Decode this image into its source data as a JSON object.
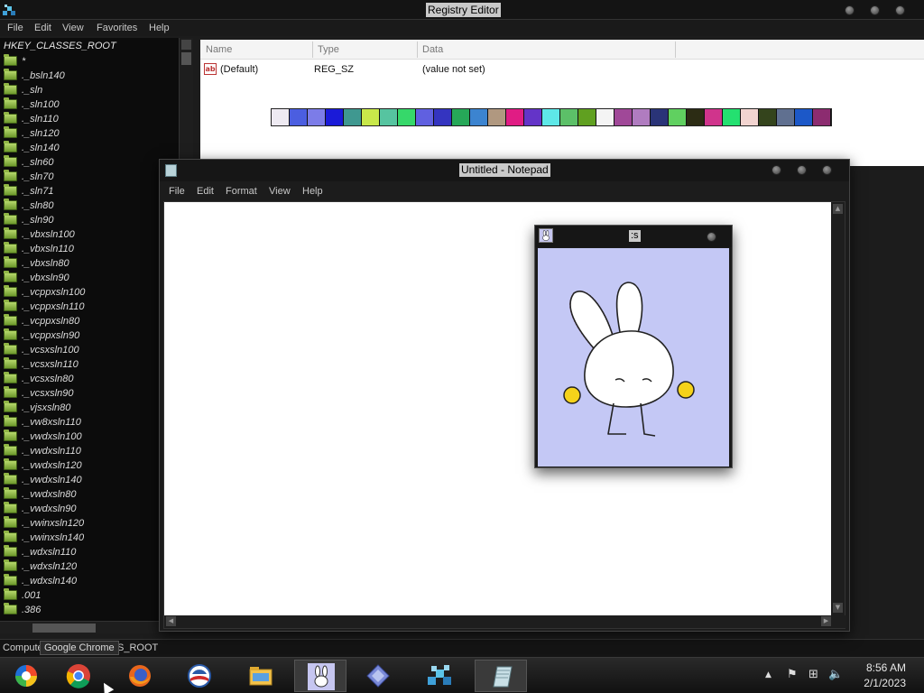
{
  "regedit": {
    "title": "Registry Editor",
    "menu": [
      "File",
      "Edit",
      "View",
      "Favorites",
      "Help"
    ],
    "tree_root": "HKEY_CLASSES_ROOT",
    "tree_items": [
      "*",
      "._bsln140",
      "._sln",
      "._sln100",
      "._sln110",
      "._sln120",
      "._sln140",
      "._sln60",
      "._sln70",
      "._sln71",
      "._sln80",
      "._sln90",
      "._vbxsln100",
      "._vbxsln110",
      "._vbxsln80",
      "._vbxsln90",
      "._vcppxsln100",
      "._vcppxsln110",
      "._vcppxsln80",
      "._vcppxsln90",
      "._vcsxsln100",
      "._vcsxsln110",
      "._vcsxsln80",
      "._vcsxsln90",
      "._vjsxsln80",
      "._vw8xsln110",
      "._vwdxsln100",
      "._vwdxsln110",
      "._vwdxsln120",
      "._vwdxsln140",
      "._vwdxsln80",
      "._vwdxsln90",
      "._vwinxsln120",
      "._vwinxsln140",
      "._wdxsln110",
      "._wdxsln120",
      "._wdxsln140",
      ".001",
      ".386"
    ],
    "columns": [
      "Name",
      "Type",
      "Data"
    ],
    "row": {
      "name": "(Default)",
      "type": "REG_SZ",
      "data": "(value not set)"
    },
    "palette": [
      "#eeeaf2",
      "#4b5ee0",
      "#7c7ce8",
      "#1a1ad8",
      "#3f9890",
      "#c8e84a",
      "#56c4a0",
      "#36d86a",
      "#6060e0",
      "#3434c0",
      "#26a858",
      "#3c84d0",
      "#b09880",
      "#e01c84",
      "#6434c8",
      "#5ee8e8",
      "#5cc068",
      "#60a020",
      "#f4f4f4",
      "#a04898",
      "#b07cc0",
      "#2a3478",
      "#60d060",
      "#2c2c14",
      "#d0348c",
      "#24e070",
      "#f2d4d0",
      "#34441c",
      "#607090",
      "#1c58c8",
      "#8c2c70"
    ],
    "status_text": "Compute",
    "status_suffix": "S_ROOT"
  },
  "tooltip": "Google Chrome",
  "notepad": {
    "title": "Untitled - Notepad",
    "menu": [
      "File",
      "Edit",
      "Format",
      "View",
      "Help"
    ]
  },
  "bunny_window": {
    "title": ":s"
  },
  "taskbar": {
    "apps": [
      "windows-media-center-icon",
      "google-chrome-icon",
      "firefox-icon",
      "campaign-logo-icon",
      "file-explorer-icon",
      "bunny-app-icon",
      "diamond-app-icon",
      "registry-editor-icon",
      "notepad-icon"
    ],
    "time": "8:56 AM",
    "date": "2/1/2023"
  }
}
